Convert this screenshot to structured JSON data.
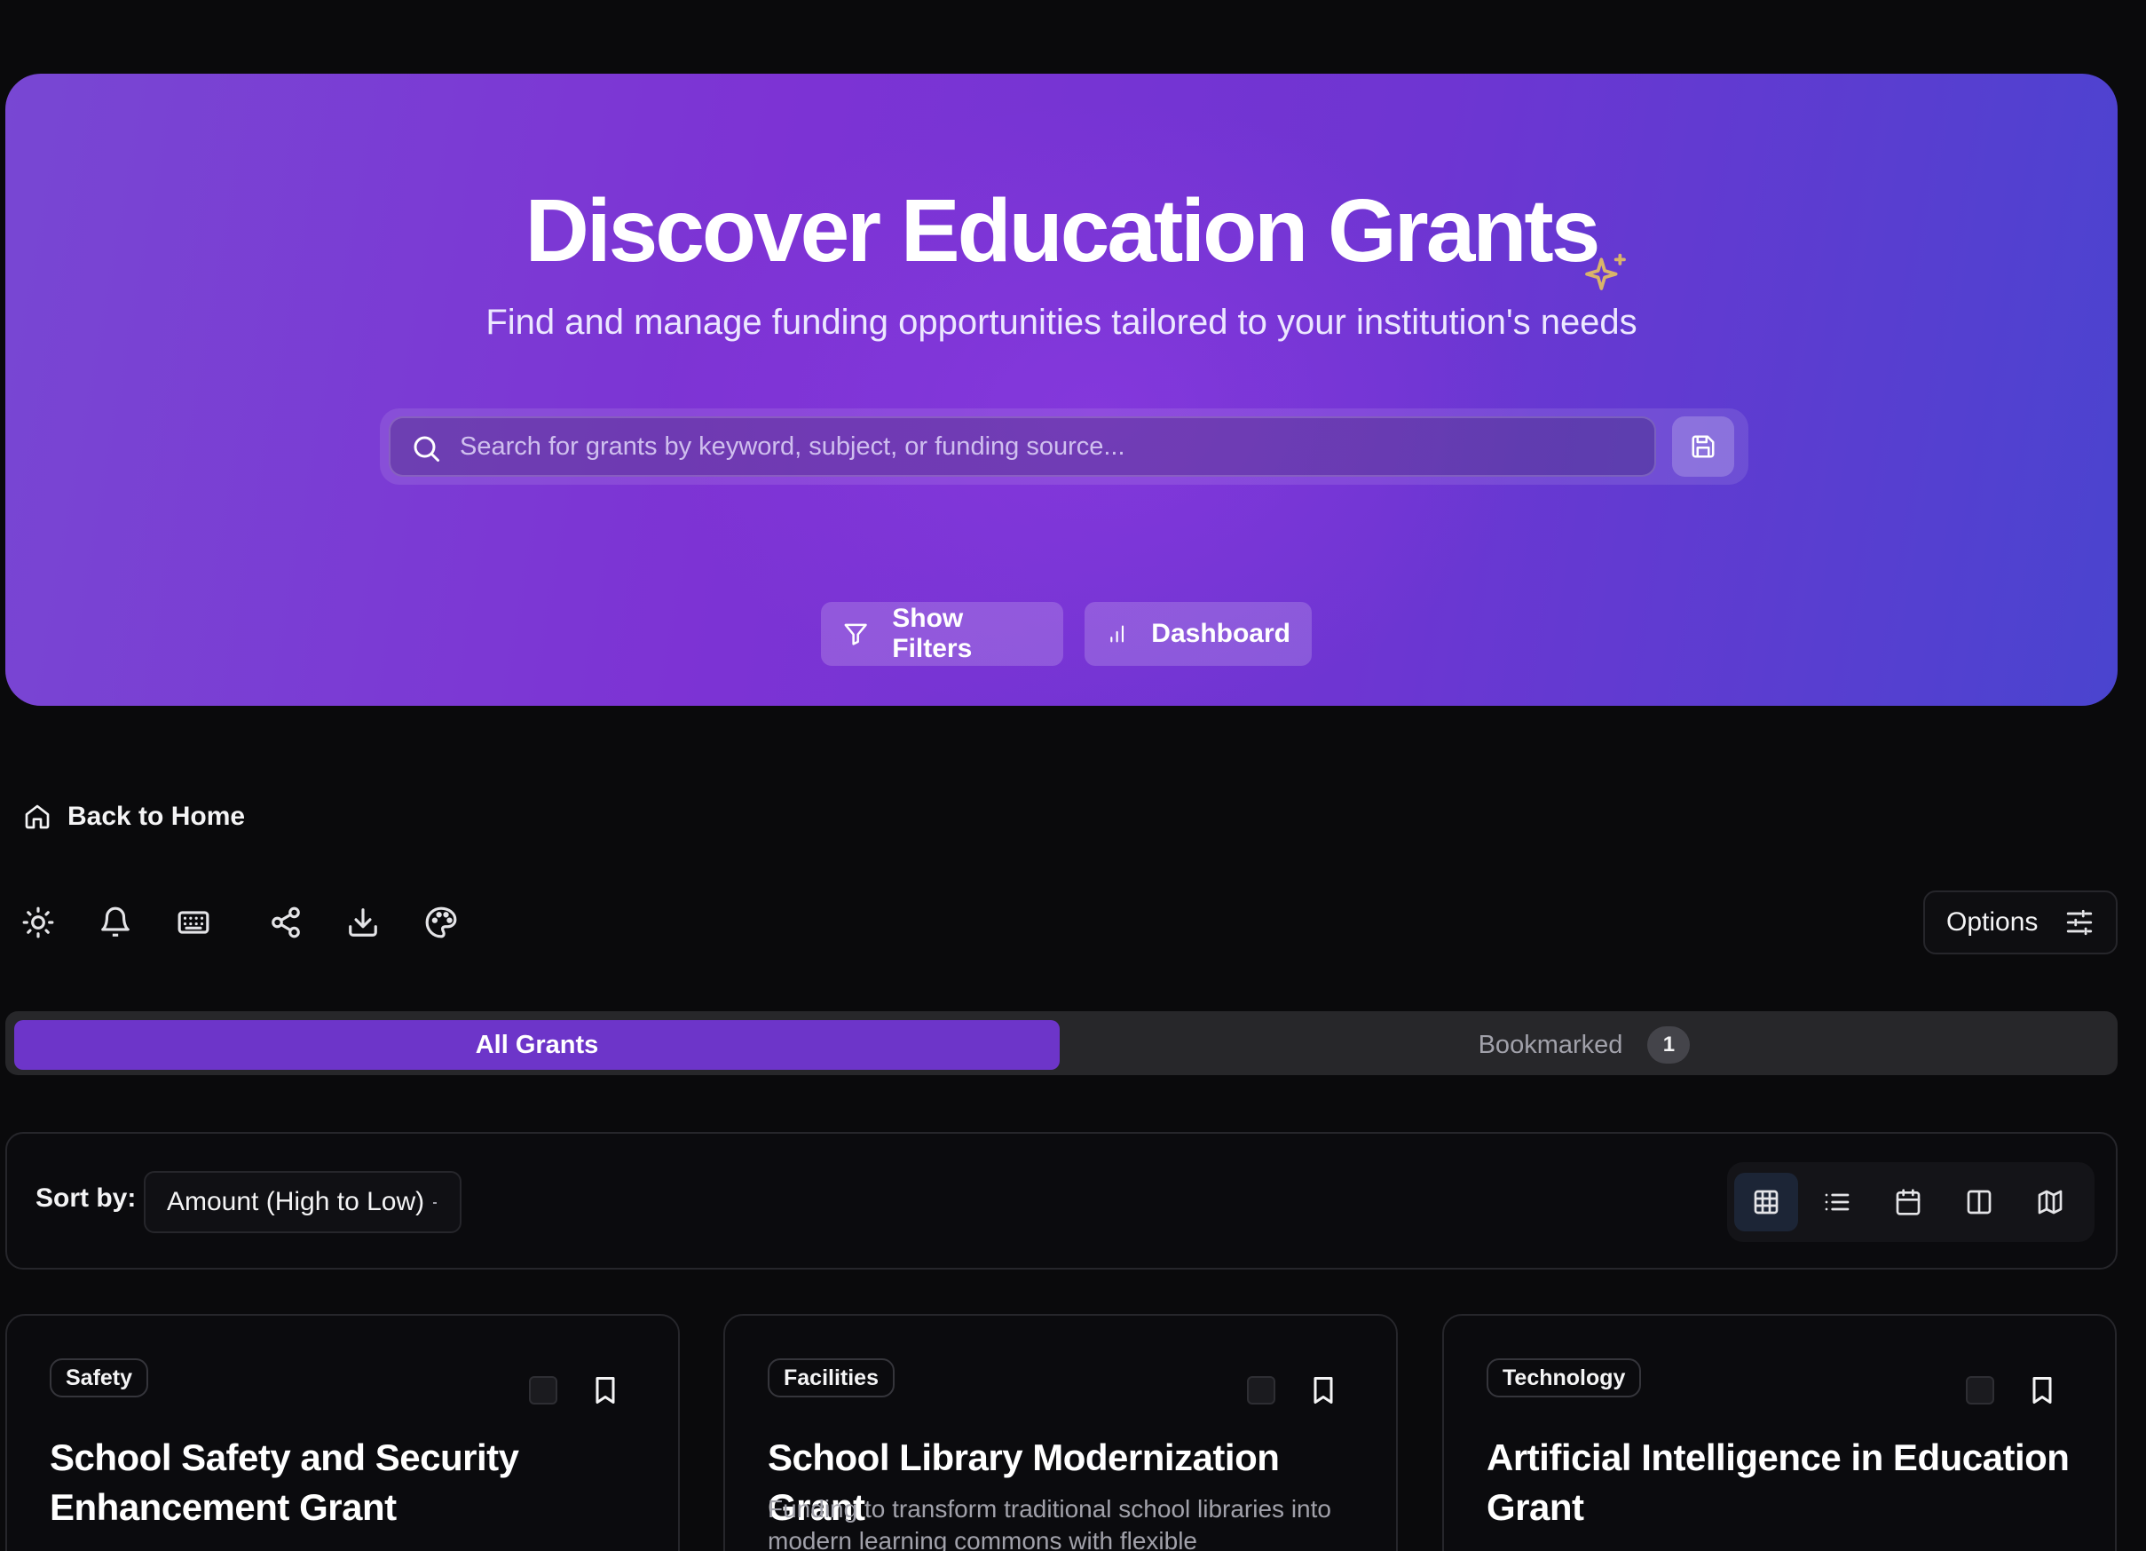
{
  "hero": {
    "title": "Discover Education Grants",
    "subtitle": "Find and manage funding opportunities tailored to your institution's needs",
    "search_placeholder": "Search for grants by keyword, subject, or funding source...",
    "show_filters_label": "Show Filters",
    "dashboard_label": "Dashboard",
    "icons": [
      "sparkle-icon",
      "search-icon",
      "save-icon",
      "filter-icon",
      "bar-chart-icon"
    ]
  },
  "nav": {
    "back_label": "Back to Home"
  },
  "toolbar": {
    "icons": [
      "sun-icon",
      "bell-icon",
      "keyboard-icon",
      "share-icon",
      "download-icon",
      "palette-icon"
    ],
    "options_label": "Options"
  },
  "tabs": {
    "all_label": "All Grants",
    "bookmarked_label": "Bookmarked",
    "bookmarked_count": "1"
  },
  "sort": {
    "label": "Sort by:",
    "selected": "Amount (High to Low)",
    "views": [
      "grid-view-icon",
      "list-view-icon",
      "calendar-view-icon",
      "split-view-icon",
      "map-view-icon"
    ],
    "active_view": "grid-view-icon"
  },
  "cards": [
    {
      "category": "Safety",
      "title": "School Safety and Security Enhancement Grant",
      "description": ""
    },
    {
      "category": "Facilities",
      "title": "School Library Modernization Grant",
      "description": "Funding to transform traditional school libraries into modern learning commons with flexible"
    },
    {
      "category": "Technology",
      "title": "Artificial Intelligence in Education Grant",
      "description": ""
    }
  ],
  "colors": {
    "background": "#0a0a0c",
    "accent": "#6d35c9",
    "sparkle": "#d9b46a"
  }
}
